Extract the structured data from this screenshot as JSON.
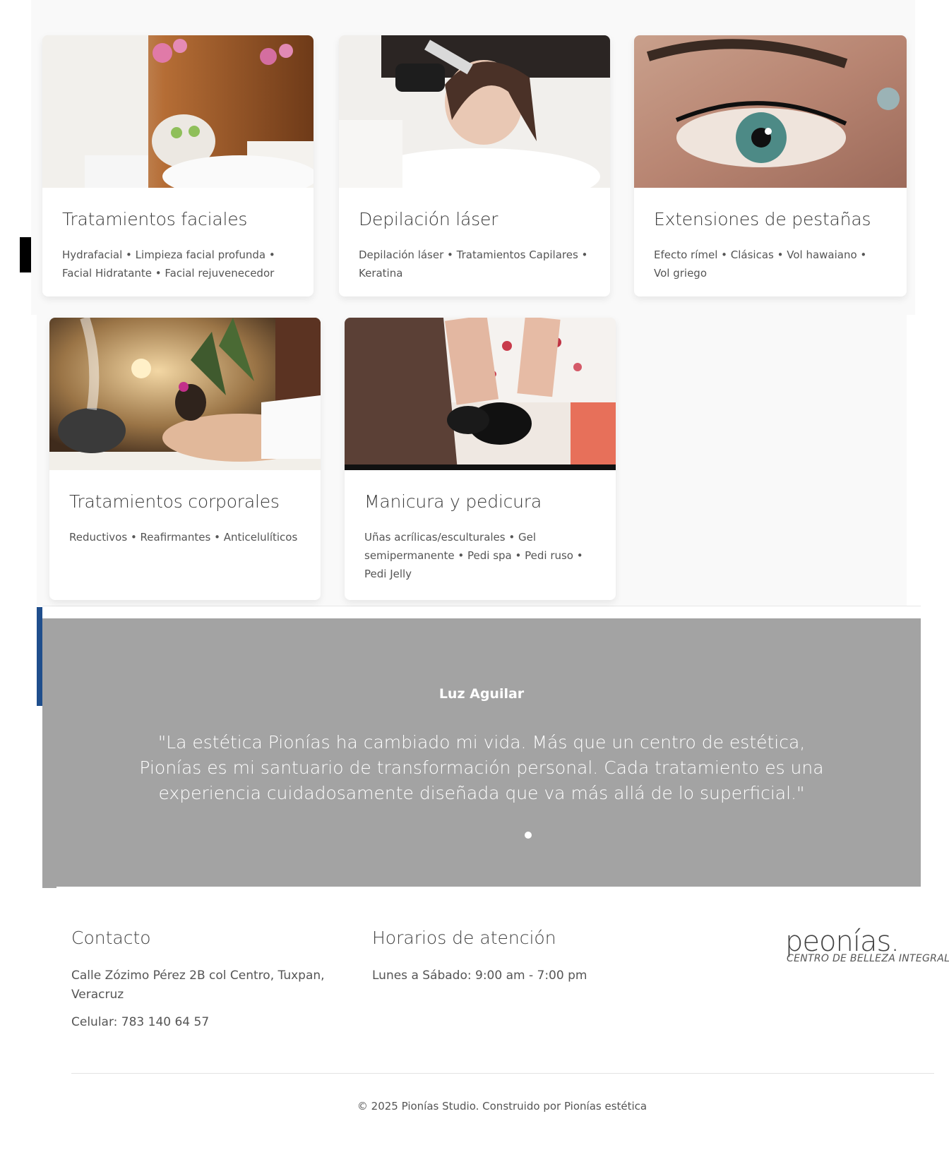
{
  "services": [
    {
      "title": "Tratamientos faciales",
      "description": "Hydrafacial • Limpieza facial profunda • Facial Hidratante • Facial rejuvenecedor",
      "image": "facial-treatment-photo"
    },
    {
      "title": "Depilación láser",
      "description": "Depilación láser • Tratamientos Capilares • Keratina",
      "image": "laser-hair-removal-photo"
    },
    {
      "title": "Extensiones de pestañas",
      "description": "Efecto rímel • Clásicas • Vol hawaiano • Vol griego",
      "image": "eyelash-extension-photo"
    },
    {
      "title": "Tratamientos corporales",
      "description": "Reductivos • Reafirmantes • Anticelulíticos",
      "image": "body-treatment-photo"
    },
    {
      "title": "Manicura y pedicura",
      "description": "Uñas acrílicas/esculturales • Gel semipermanente • Pedi spa • Pedi ruso • Pedi Jelly",
      "image": "manicure-pedicure-photo"
    }
  ],
  "testimonial": {
    "name": "Luz Aguilar",
    "quote": "\"La estética Pionías ha cambiado mi vida. Más que un centro de estética, Pionías es mi santuario de transformación personal. Cada tratamiento es una experiencia cuidadosamente diseñada que va más allá de lo superficial.\"",
    "slides_total": 1,
    "active_slide": 1
  },
  "footer": {
    "contact": {
      "heading": "Contacto",
      "address": "Calle Zózimo Pérez 2B col Centro, Tuxpan, Veracruz",
      "phone": "Celular: 783 140 64 57"
    },
    "hours": {
      "heading": "Horarios de atención",
      "schedule": "Lunes a Sábado: 9:00 am - 7:00 pm"
    },
    "logo": {
      "main": "peonías.",
      "sub": "CENTRO DE BELLEZA INTEGRAL"
    },
    "copyright": "© 2025 Pionías Studio. Construido por Pionías estética"
  },
  "colors": {
    "testimonial_bg": "#a3a3a3",
    "panel_bg": "#f9f9f9",
    "text_dark": "#3a3a3a"
  }
}
